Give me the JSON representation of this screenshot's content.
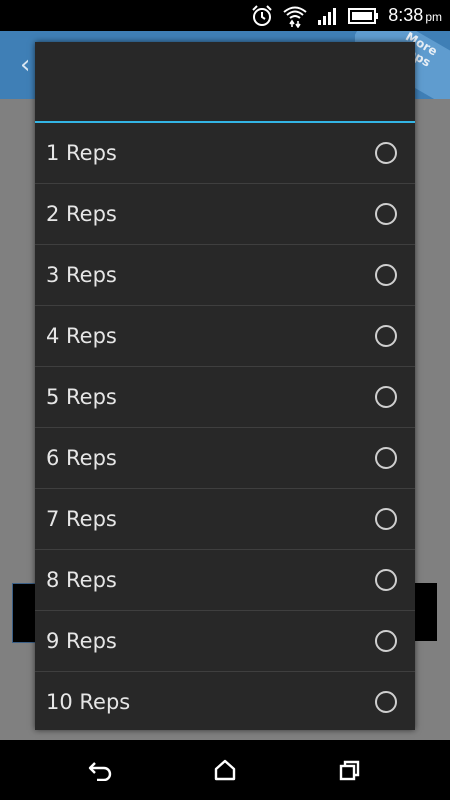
{
  "status_bar": {
    "time": "8:38",
    "ampm": "pm",
    "icons": [
      "alarm-icon",
      "wifi-icon",
      "signal-icon",
      "battery-icon"
    ]
  },
  "app": {
    "ribbon_text": "More Apps",
    "header_color": "#3f7fb6"
  },
  "dialog": {
    "accent": "#33b5e5",
    "options": [
      {
        "label": "1 Reps",
        "selected": false
      },
      {
        "label": "2 Reps",
        "selected": false
      },
      {
        "label": "3 Reps",
        "selected": false
      },
      {
        "label": "4 Reps",
        "selected": false
      },
      {
        "label": "5 Reps",
        "selected": false
      },
      {
        "label": "6 Reps",
        "selected": false
      },
      {
        "label": "7 Reps",
        "selected": false
      },
      {
        "label": "8 Reps",
        "selected": false
      },
      {
        "label": "9 Reps",
        "selected": false
      },
      {
        "label": "10 Reps",
        "selected": false
      }
    ]
  },
  "nav_bar": {
    "buttons": [
      "back-icon",
      "home-icon",
      "recent-apps-icon"
    ]
  }
}
